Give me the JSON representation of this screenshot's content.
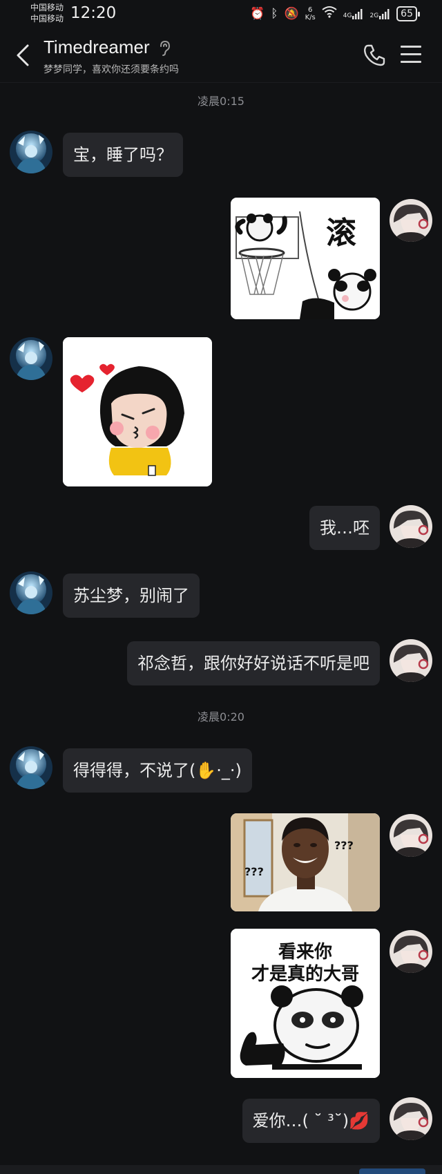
{
  "status_bar": {
    "carrier_1": "中国移动",
    "carrier_2": "中国移动",
    "time": "12:20",
    "net_speed_value": "6",
    "net_speed_unit": "K/s",
    "signal_1": "4G",
    "signal_2": "2G",
    "battery": "65"
  },
  "header": {
    "contact_name": "Timedreamer",
    "subtitle": "梦梦同学，喜欢你还须要条约吗"
  },
  "messages": {
    "time_1": "凌晨0:15",
    "m1": "宝，睡了吗？",
    "sticker_gun": "滚",
    "m4": "我…呸",
    "m5": "苏尘梦，别闹了",
    "m6": "祁念哲，跟你好好说话不听是吧",
    "time_2": "凌晨0:20",
    "m7": "得得得，不说了(✋·_·)",
    "sticker_q1": "???",
    "sticker_q2": "???",
    "sticker_dage_l1": "看来你",
    "sticker_dage_l2": "才是真的大哥",
    "m10": "爱你…( ˘ ³˘)💋"
  },
  "colors": {
    "background": "#111214",
    "bubble": "#26272b",
    "text": "#ececec",
    "muted": "#8d8e93"
  }
}
